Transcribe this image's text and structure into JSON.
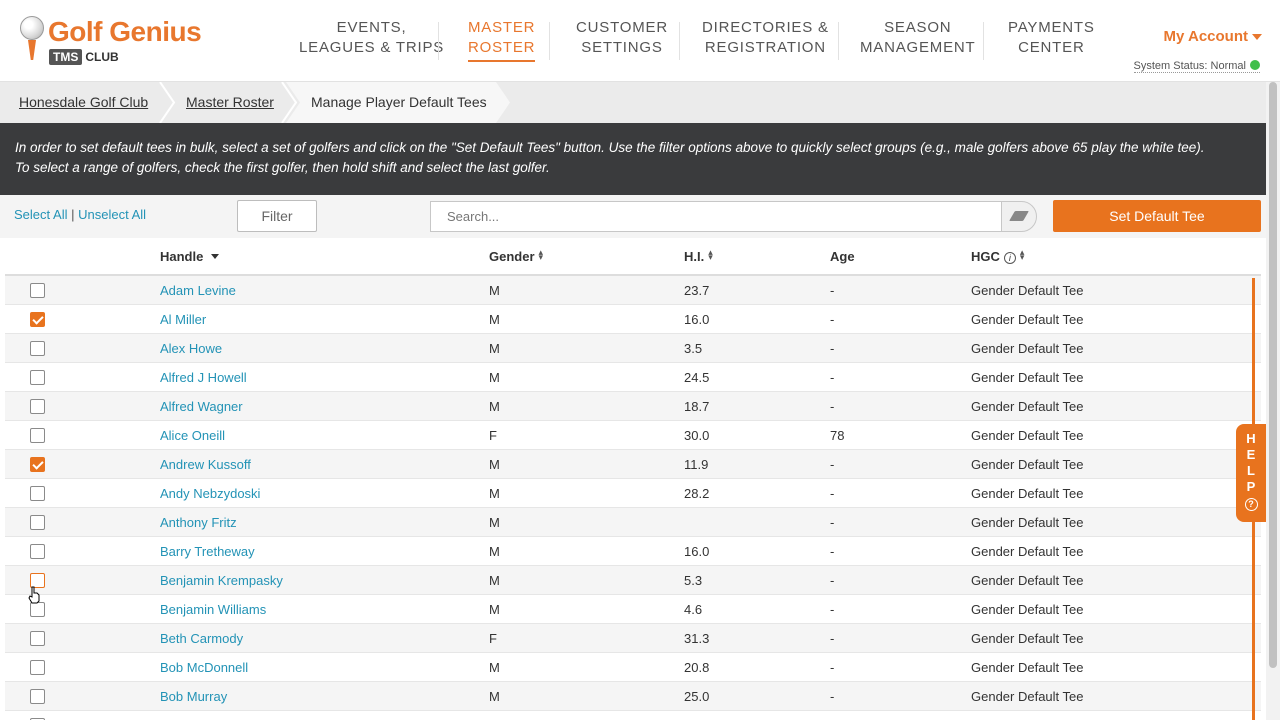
{
  "header": {
    "logo_text": "Golf Genius",
    "logo_tms": "TMS",
    "logo_club": "CLUB",
    "nav": [
      {
        "line1": "EVENTS,",
        "line2": "LEAGUES & TRIPS",
        "active": false
      },
      {
        "line1": "MASTER",
        "line2": "ROSTER",
        "active": true
      },
      {
        "line1": "CUSTOMER",
        "line2": "SETTINGS",
        "active": false
      },
      {
        "line1": "DIRECTORIES &",
        "line2": "REGISTRATION",
        "active": false
      },
      {
        "line1": "SEASON",
        "line2": "MANAGEMENT",
        "active": false
      },
      {
        "line1": "PAYMENTS",
        "line2": "CENTER",
        "active": false
      }
    ],
    "account_label": "My Account",
    "status_label": "System Status: Normal",
    "status_color": "#3fbf4b"
  },
  "breadcrumb": [
    "Honesdale Golf Club",
    "Master Roster",
    "Manage Player Default Tees"
  ],
  "banner": {
    "line1": "In order to set default tees in bulk, select a set of golfers and click on the \"Set Default Tees\" button. Use the filter options above to quickly select groups (e.g., male golfers above 65 play the white tee).",
    "line2": "To select a range of golfers, check the first golfer, then hold shift and select the last golfer."
  },
  "toolbar": {
    "select_all": "Select All",
    "separator": "|",
    "unselect_all": "Unselect All",
    "filter_label": "Filter",
    "search_placeholder": "Search...",
    "set_tee_label": "Set Default Tee"
  },
  "table": {
    "columns": {
      "handle": "Handle",
      "gender": "Gender",
      "hi": "H.I.",
      "age": "Age",
      "hgc": "HGC"
    },
    "rows": [
      {
        "checked": false,
        "name": "Adam Levine",
        "gender": "M",
        "hi": "23.7",
        "age": "-",
        "hgc": "Gender Default Tee"
      },
      {
        "checked": true,
        "name": "Al Miller",
        "gender": "M",
        "hi": "16.0",
        "age": "-",
        "hgc": "Gender Default Tee"
      },
      {
        "checked": false,
        "name": "Alex Howe",
        "gender": "M",
        "hi": "3.5",
        "age": "-",
        "hgc": "Gender Default Tee"
      },
      {
        "checked": false,
        "name": "Alfred J Howell",
        "gender": "M",
        "hi": "24.5",
        "age": "-",
        "hgc": "Gender Default Tee"
      },
      {
        "checked": false,
        "name": "Alfred Wagner",
        "gender": "M",
        "hi": "18.7",
        "age": "-",
        "hgc": "Gender Default Tee"
      },
      {
        "checked": false,
        "name": "Alice Oneill",
        "gender": "F",
        "hi": "30.0",
        "age": "78",
        "hgc": "Gender Default Tee"
      },
      {
        "checked": true,
        "name": "Andrew Kussoff",
        "gender": "M",
        "hi": "11.9",
        "age": "-",
        "hgc": "Gender Default Tee"
      },
      {
        "checked": false,
        "name": "Andy Nebzydoski",
        "gender": "M",
        "hi": "28.2",
        "age": "-",
        "hgc": "Gender Default Tee"
      },
      {
        "checked": false,
        "name": "Anthony Fritz",
        "gender": "M",
        "hi": "",
        "age": "-",
        "hgc": "Gender Default Tee"
      },
      {
        "checked": false,
        "name": "Barry Tretheway",
        "gender": "M",
        "hi": "16.0",
        "age": "-",
        "hgc": "Gender Default Tee"
      },
      {
        "checked": false,
        "name": "Benjamin Krempasky",
        "gender": "M",
        "hi": "5.3",
        "age": "-",
        "hgc": "Gender Default Tee",
        "hover": true
      },
      {
        "checked": false,
        "name": "Benjamin Williams",
        "gender": "M",
        "hi": "4.6",
        "age": "-",
        "hgc": "Gender Default Tee"
      },
      {
        "checked": false,
        "name": "Beth Carmody",
        "gender": "F",
        "hi": "31.3",
        "age": "-",
        "hgc": "Gender Default Tee"
      },
      {
        "checked": false,
        "name": "Bob McDonnell",
        "gender": "M",
        "hi": "20.8",
        "age": "-",
        "hgc": "Gender Default Tee"
      },
      {
        "checked": false,
        "name": "Bob Murray",
        "gender": "M",
        "hi": "25.0",
        "age": "-",
        "hgc": "Gender Default Tee"
      },
      {
        "checked": false,
        "name": "",
        "gender": "",
        "hi": "",
        "age": "",
        "hgc": ""
      }
    ]
  },
  "help": {
    "letters": [
      "H",
      "E",
      "L",
      "P"
    ],
    "icon": "?"
  },
  "colors": {
    "accent": "#e8731e",
    "link": "#2393b6",
    "banner_bg": "#3a3b3d"
  }
}
